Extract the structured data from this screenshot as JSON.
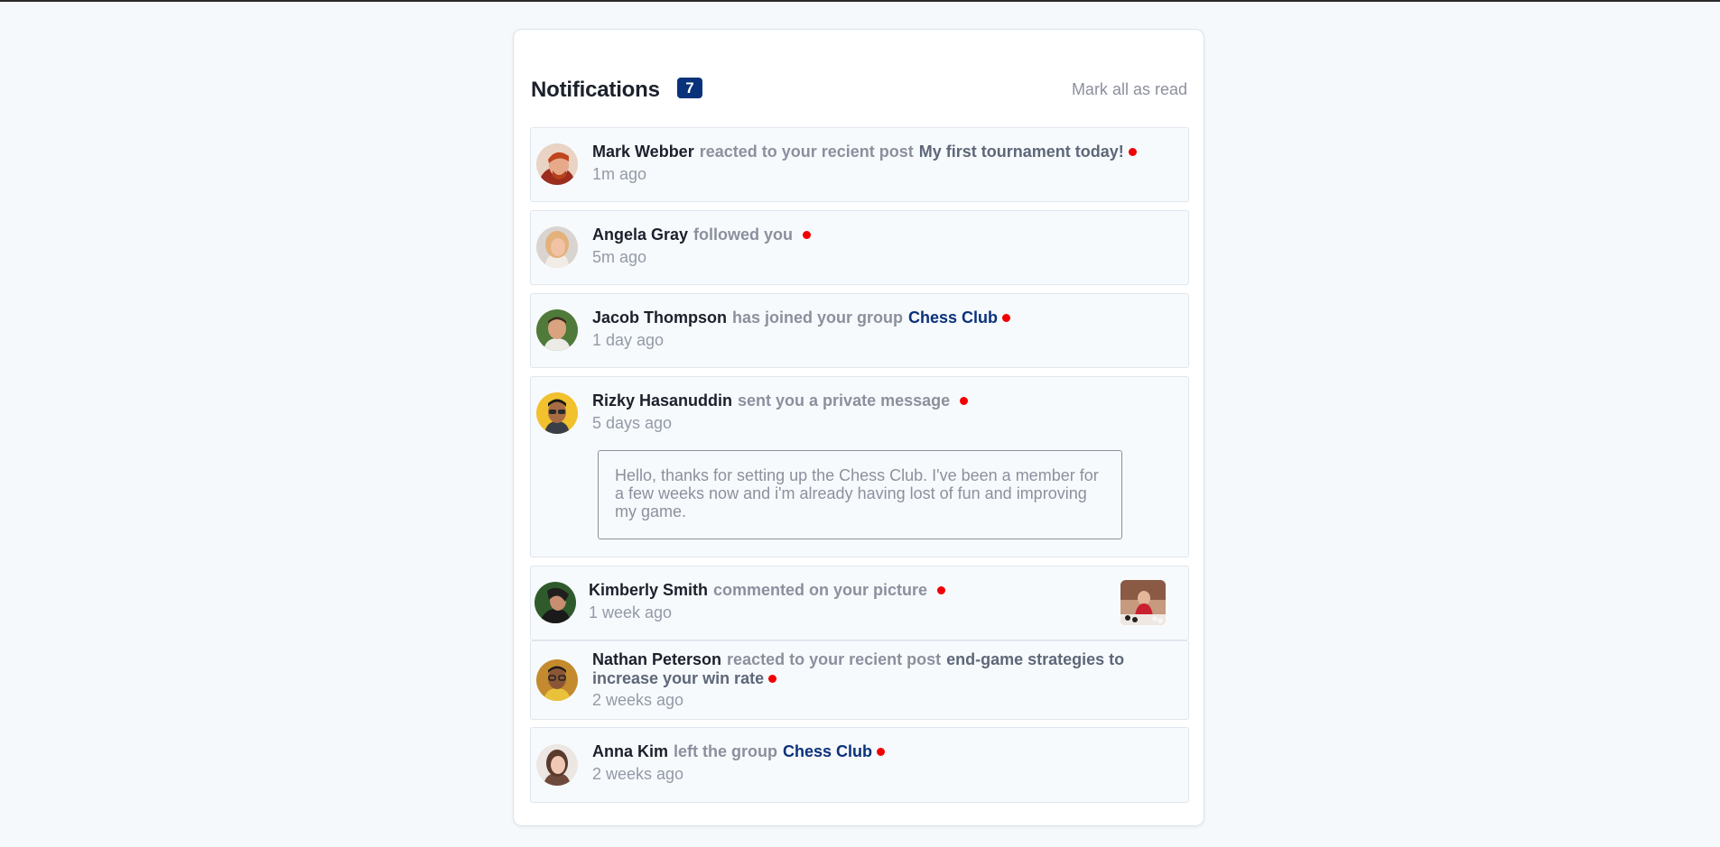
{
  "header": {
    "title": "Notifications",
    "unread_count": "7",
    "mark_all_label": "Mark all as read"
  },
  "notifications": [
    {
      "name": "Mark Webber",
      "action": "reacted to your recient post",
      "target": "My first tournament today!",
      "time": "1m ago"
    },
    {
      "name": "Angela Gray",
      "action": "followed you",
      "time": "5m ago"
    },
    {
      "name": "Jacob Thompson",
      "action": "has joined your group",
      "target": "Chess Club",
      "time": "1 day ago"
    },
    {
      "name": "Rizky Hasanuddin",
      "action": "sent you a private message",
      "time": "5 days ago",
      "message": "Hello, thanks for setting up the Chess Club. I've been a member for a few weeks now and i'm already having lost of fun and improving my game."
    },
    {
      "name": "Kimberly Smith",
      "action": "commented on your picture",
      "time": "1 week ago"
    },
    {
      "name": "Nathan Peterson",
      "action": "reacted to your recient post",
      "target": "end-game strategies to increase your win rate",
      "time": "2 weeks ago"
    },
    {
      "name": "Anna Kim",
      "action": "left the group",
      "target": "Chess Club",
      "time": "2 weeks ago"
    }
  ],
  "colors": {
    "badge": "#0a327b",
    "unread_dot": "#f00000",
    "name": "#1c202b",
    "muted": "#8c909d",
    "group_link": "#0a327b",
    "card_bg": "#f7fafd"
  }
}
